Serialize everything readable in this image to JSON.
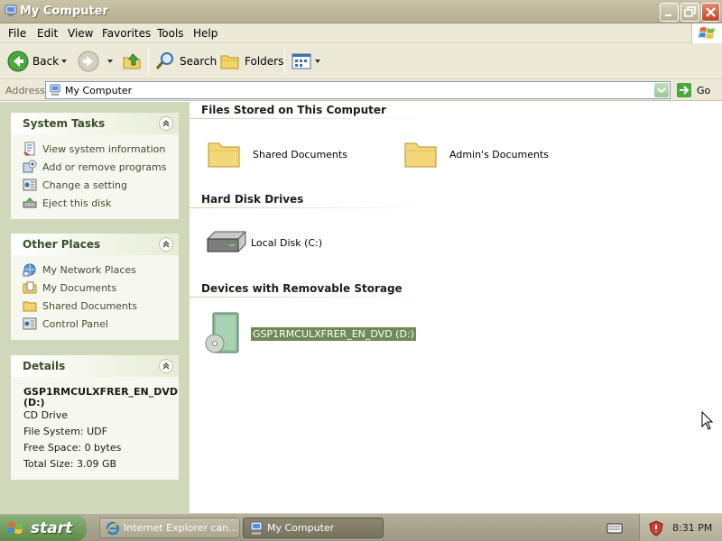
{
  "window": {
    "title": "My Computer",
    "icons": {
      "app": "my-computer-icon",
      "minimize": "minimize-icon",
      "maximize": "maximize-icon",
      "close": "close-icon"
    }
  },
  "menu": [
    "File",
    "Edit",
    "View",
    "Favorites",
    "Tools",
    "Help"
  ],
  "toolbar": {
    "back_label": "Back",
    "search_label": "Search",
    "folders_label": "Folders"
  },
  "address": {
    "label": "Address",
    "value": "My Computer",
    "go_label": "Go"
  },
  "system_tasks": {
    "title": "System Tasks",
    "items": [
      {
        "label": "View system information",
        "icon": "system-info-icon"
      },
      {
        "label": "Add or remove programs",
        "icon": "add-remove-icon"
      },
      {
        "label": "Change a setting",
        "icon": "control-panel-icon"
      },
      {
        "label": "Eject this disk",
        "icon": "eject-icon"
      }
    ]
  },
  "other_places": {
    "title": "Other Places",
    "items": [
      {
        "label": "My Network Places",
        "icon": "network-icon"
      },
      {
        "label": "My Documents",
        "icon": "documents-icon"
      },
      {
        "label": "Shared Documents",
        "icon": "folder-icon"
      },
      {
        "label": "Control Panel",
        "icon": "control-panel-icon"
      }
    ]
  },
  "details": {
    "title": "Details",
    "name_line1": "GSP1RMCULXFRER_EN_DVD",
    "name_line2": "(D:)",
    "type": "CD Drive",
    "file_system": "File System: UDF",
    "free_space": "Free Space: 0 bytes",
    "total_size": "Total Size: 3.09 GB"
  },
  "groups": {
    "files_stored": {
      "title": "Files Stored on This Computer",
      "items": [
        "Shared Documents",
        "Admin's Documents"
      ]
    },
    "hard_disks": {
      "title": "Hard Disk Drives",
      "items": [
        "Local Disk (C:)"
      ]
    },
    "removable": {
      "title": "Devices with Removable Storage",
      "items": [
        "GSP1RMCULXFRER_EN_DVD (D:)"
      ]
    }
  },
  "taskbar": {
    "start_label": "start",
    "tasks": [
      "Internet Explorer can...",
      "My Computer"
    ],
    "clock": "8:31 PM"
  },
  "colors": {
    "left_pane": "#cfd8b8",
    "selection": "#6d8a57",
    "start_button": "#6f9a5c"
  }
}
